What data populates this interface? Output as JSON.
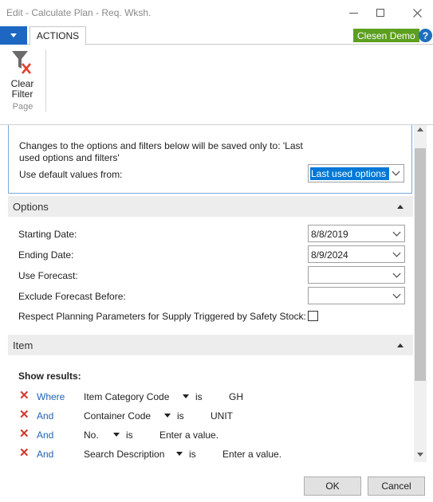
{
  "window": {
    "title": "Edit - Calculate Plan - Req. Wksh."
  },
  "ribbon": {
    "tab": "ACTIONS",
    "company": "Clesen Demo",
    "help": "?",
    "clear_filter_line1": "Clear",
    "clear_filter_line2": "Filter",
    "group": "Page"
  },
  "savebox": {
    "message": "Changes to the options and filters below will be saved only to: 'Last used options and filters'",
    "default_label": "Use default values from:",
    "default_value": "Last used options and filters"
  },
  "options": {
    "header": "Options",
    "starting_date_label": "Starting Date:",
    "starting_date": "8/8/2019",
    "ending_date_label": "Ending Date:",
    "ending_date": "8/9/2024",
    "use_forecast_label": "Use Forecast:",
    "use_forecast": "",
    "exclude_forecast_label": "Exclude Forecast Before:",
    "exclude_forecast": "",
    "respect_label": "Respect Planning Parameters for Supply Triggered by Safety Stock:",
    "respect_checked": false
  },
  "item": {
    "header": "Item",
    "show_results": "Show results:",
    "filters": [
      {
        "conj": "Where",
        "field": "Item Category Code",
        "op": "is",
        "value": "GH"
      },
      {
        "conj": "And",
        "field": "Container Code",
        "op": "is",
        "value": "UNIT"
      },
      {
        "conj": "And",
        "field": "No.",
        "op": "is",
        "value": "Enter a value."
      },
      {
        "conj": "And",
        "field": "Search Description",
        "op": "is",
        "value": "Enter a value."
      }
    ]
  },
  "footer": {
    "ok": "OK",
    "cancel": "Cancel"
  },
  "colors": {
    "accent": "#1d67c2",
    "company_badge": "#5c9f1f",
    "remove_filter": "#d2372a",
    "link": "#1e63b8"
  }
}
